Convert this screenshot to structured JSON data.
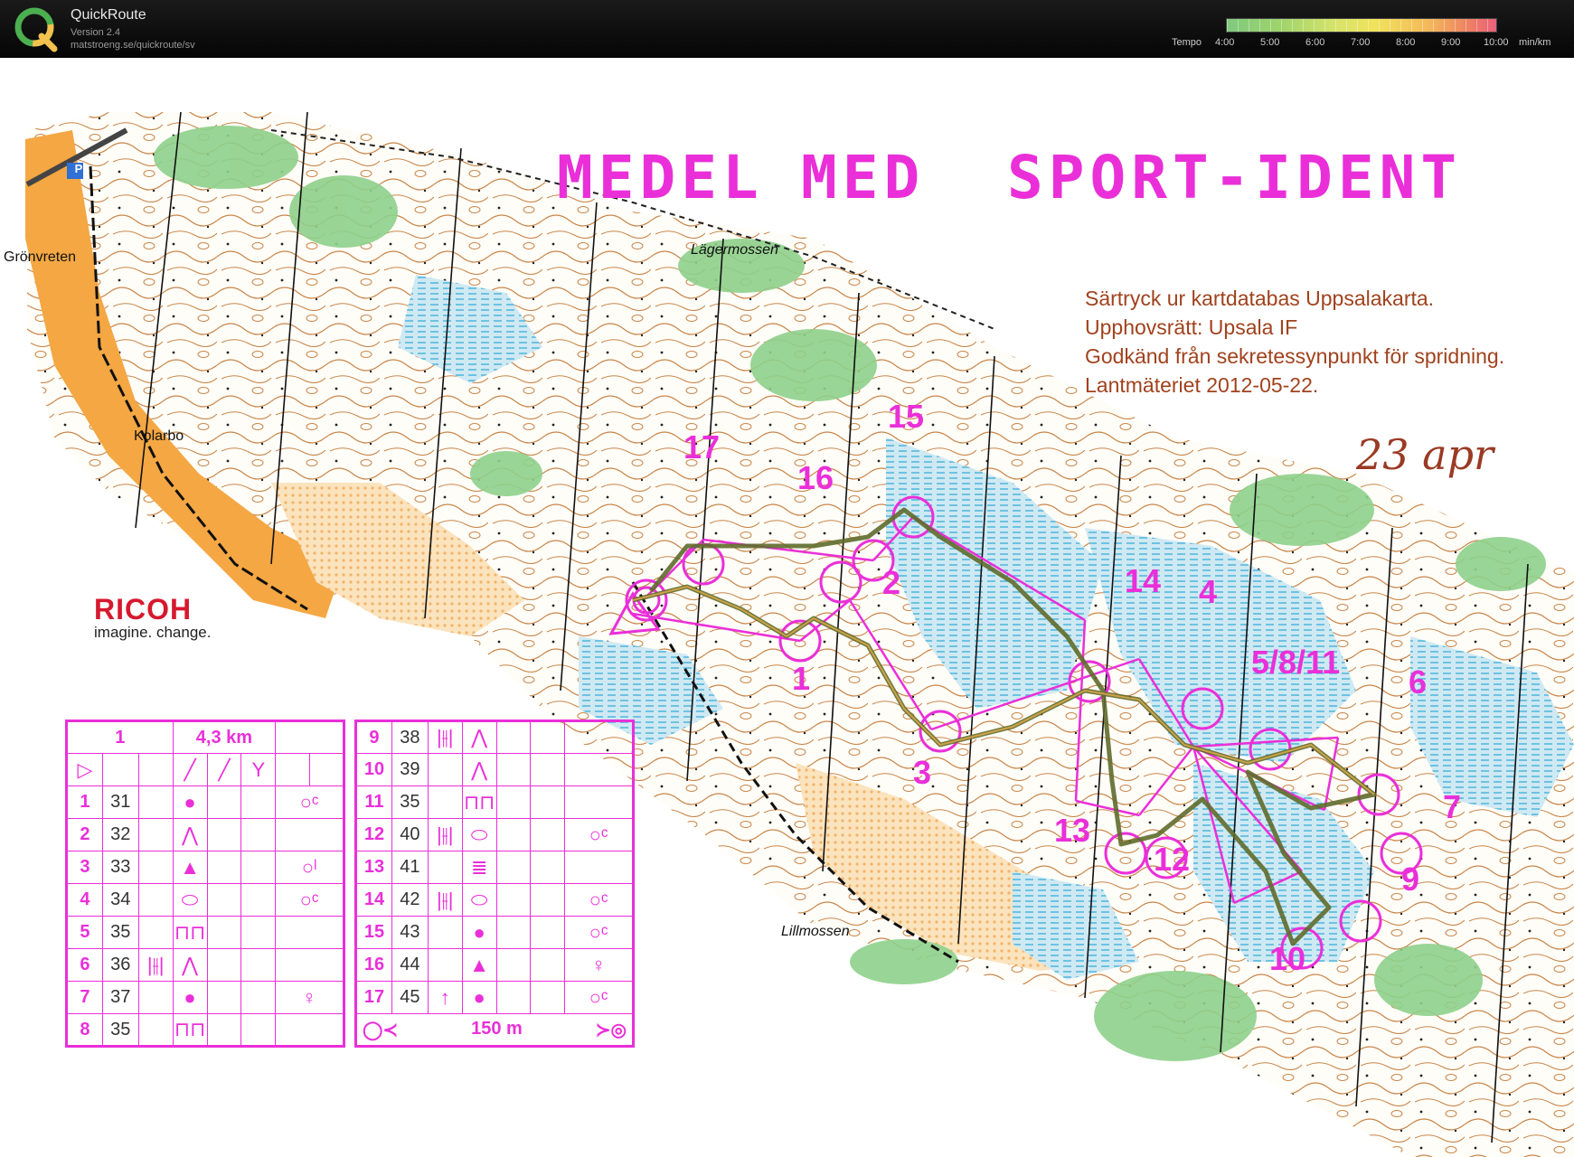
{
  "app": {
    "title": "QuickRoute",
    "version": "Version 2.4",
    "url": "matstroeng.se/quickroute/sv"
  },
  "legend": {
    "label": "Tempo",
    "ticks": [
      "4:00",
      "5:00",
      "6:00",
      "7:00",
      "8:00",
      "9:00",
      "10:00"
    ],
    "unit": "min/km"
  },
  "map": {
    "title_words": [
      "MEDEL",
      "MED",
      "SPORT-IDENT"
    ],
    "places": {
      "gronvreten": "Grönvreten",
      "kolarbo": "Kolarbo",
      "lagermossen": "Lägermossen",
      "lillmossen": "Lillmossen"
    },
    "credits": [
      "Särtryck ur kartdatabas Uppsalakarta.",
      "Upphovsrätt: Upsala IF",
      "Godkänd från sekretessynpunkt för spridning.",
      "Lantmäteriet 2012-05-22."
    ],
    "date": "23 apr",
    "sponsor": {
      "name": "RICOH",
      "tagline": "imagine. change."
    },
    "parking_icon": "P",
    "controls": [
      {
        "label": "1",
        "num": 1
      },
      {
        "label": "2",
        "num": 2
      },
      {
        "label": "3",
        "num": 3
      },
      {
        "label": "4",
        "num": 4
      },
      {
        "label": "5/8/11",
        "num": 5
      },
      {
        "label": "6",
        "num": 6
      },
      {
        "label": "7",
        "num": 7
      },
      {
        "label": "9",
        "num": 9
      },
      {
        "label": "10",
        "num": 10
      },
      {
        "label": "12",
        "num": 12
      },
      {
        "label": "13",
        "num": 13
      },
      {
        "label": "14",
        "num": 14
      },
      {
        "label": "15",
        "num": 15
      },
      {
        "label": "16",
        "num": 16
      },
      {
        "label": "17",
        "num": 17
      }
    ]
  },
  "description": {
    "course": "1",
    "length": "4,3 km",
    "start_symbol": "start-triangle-icon",
    "finish_text": "150 m",
    "left_rows": [
      {
        "n": "1",
        "code": "31",
        "d1": "",
        "d2": "●",
        "d3": "",
        "d4": "",
        "d5": "○ᶜ"
      },
      {
        "n": "2",
        "code": "32",
        "d1": "",
        "d2": "⋀",
        "d3": "",
        "d4": "",
        "d5": ""
      },
      {
        "n": "3",
        "code": "33",
        "d1": "",
        "d2": "▲",
        "d3": "",
        "d4": "",
        "d5": "○ˡ"
      },
      {
        "n": "4",
        "code": "34",
        "d1": "",
        "d2": "⬭",
        "d3": "",
        "d4": "",
        "d5": "○ᶜ"
      },
      {
        "n": "5",
        "code": "35",
        "d1": "",
        "d2": "⊓⊓",
        "d3": "",
        "d4": "",
        "d5": ""
      },
      {
        "n": "6",
        "code": "36",
        "d1": "|⫲|",
        "d2": "⋀",
        "d3": "",
        "d4": "",
        "d5": ""
      },
      {
        "n": "7",
        "code": "37",
        "d1": "",
        "d2": "●",
        "d3": "",
        "d4": "",
        "d5": "♀"
      },
      {
        "n": "8",
        "code": "35",
        "d1": "",
        "d2": "⊓⊓",
        "d3": "",
        "d4": "",
        "d5": ""
      }
    ],
    "right_rows": [
      {
        "n": "9",
        "code": "38",
        "d1": "|⫲|",
        "d2": "⋀",
        "d3": "",
        "d4": "",
        "d5": ""
      },
      {
        "n": "10",
        "code": "39",
        "d1": "",
        "d2": "⋀",
        "d3": "",
        "d4": "",
        "d5": ""
      },
      {
        "n": "11",
        "code": "35",
        "d1": "",
        "d2": "⊓⊓",
        "d3": "",
        "d4": "",
        "d5": ""
      },
      {
        "n": "12",
        "code": "40",
        "d1": "|⫲|",
        "d2": "⬭",
        "d3": "",
        "d4": "",
        "d5": "○ᶜ"
      },
      {
        "n": "13",
        "code": "41",
        "d1": "",
        "d2": "≣",
        "d3": "",
        "d4": "",
        "d5": ""
      },
      {
        "n": "14",
        "code": "42",
        "d1": "|⫲|",
        "d2": "⬭",
        "d3": "",
        "d4": "",
        "d5": "○ᶜ"
      },
      {
        "n": "15",
        "code": "43",
        "d1": "",
        "d2": "●",
        "d3": "",
        "d4": "",
        "d5": "○ᶜ"
      },
      {
        "n": "16",
        "code": "44",
        "d1": "",
        "d2": "▲",
        "d3": "",
        "d4": "",
        "d5": "♀"
      },
      {
        "n": "17",
        "code": "45",
        "d1": "↑",
        "d2": "●",
        "d3": "",
        "d4": "",
        "d5": "○ᶜ"
      }
    ]
  }
}
